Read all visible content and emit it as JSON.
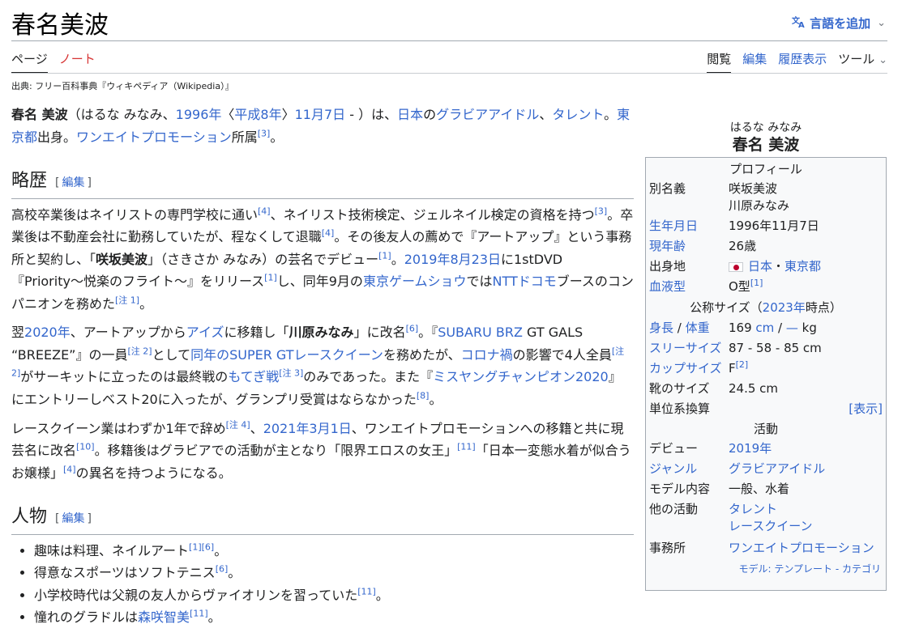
{
  "header": {
    "title": "春名美波",
    "lang_button": "言語を追加",
    "lang_icon": "translate-icon"
  },
  "tabs": {
    "page": "ページ",
    "talk": "ノート",
    "read": "閲覧",
    "edit": "編集",
    "history": "履歴表示",
    "tools": "ツール"
  },
  "source": "出典: フリー百科事典『ウィキペディア（Wikipedia）』",
  "intro": {
    "name_bold": "春名 美波",
    "t1": "（はるな みなみ、",
    "l_1996": "1996年",
    "t2": "〈",
    "l_heisei": "平成8年",
    "t3": "〉",
    "l_nov7": "11月7日",
    "t4": " - ）は、",
    "l_japan": "日本",
    "t5": "の",
    "l_gravure": "グラビアアイドル",
    "t6": "、",
    "l_talent": "タレント",
    "t7": "。",
    "l_tokyo": "東京都",
    "t8": "出身。",
    "l_oneeight": "ワンエイトプロモーション",
    "t9": "所属",
    "ref": "[3]",
    "t10": "。"
  },
  "section1": {
    "heading": "略歴",
    "edit_open": "[",
    "edit": "編集",
    "edit_close": "]",
    "p1": {
      "a": "高校卒業後はネイリストの専門学校に通い",
      "r1": "[4]",
      "b": "、ネイリスト技術検定、ジェルネイル検定の資格を持つ",
      "r2": "[3]",
      "c": "。卒業後は不動産会社に勤務していたが、程なくして退職",
      "r3": "[4]",
      "d": "。その後友人の薦めで『アートアップ』という事務所と契約し、「",
      "bold": "咲坂美波",
      "e": "」（さきさか みなみ）の芸名でデビュー",
      "r4": "[1]",
      "f": "。",
      "l_date": "2019年8月23日",
      "g": "に1stDVD『Priority〜悦楽のフライト〜』をリリース",
      "r5": "[1]",
      "h": "し、同年9月の",
      "l_tgs": "東京ゲームショウ",
      "i": "では",
      "l_ntt": "NTTドコモ",
      "j": "ブースのコンパニオンを務めた",
      "r6": "[注 1]",
      "k": "。"
    },
    "p2": {
      "a": "翌",
      "l_2020": "2020年",
      "b": "、アートアップから",
      "l_ize": "アイズ",
      "c": "に移籍し「",
      "bold": "川原みなみ",
      "d": "」に改名",
      "r1": "[6]",
      "e": "。『",
      "l_brz": "SUBARU BRZ",
      "f": " GT GALS “BREEZE”』の一員",
      "r2": "[注 2]",
      "g": "として",
      "l_super": "同年のSUPER GTレースクイーン",
      "h": "を務めたが、",
      "l_corona": "コロナ禍",
      "i": "の影響で4人全員",
      "r3": "[注 2]",
      "j": "がサーキットに立ったのは最終戦の",
      "l_motegi": "もてぎ戦",
      "r4": "[注 3]",
      "k": "のみであった。また『",
      "l_miss": "ミスヤングチャンピオン2020",
      "l": "』にエントリーしベスト20に入ったが、グランプリ受賞はならなかった",
      "r5": "[8]",
      "m": "。"
    },
    "p3": {
      "a": "レースクイーン業はわずか1年で辞め",
      "r1": "[注 4]",
      "b": "、",
      "l_date": "2021年3月1日",
      "c": "、ワンエイトプロモーションへの移籍と共に現芸名に改名",
      "r2": "[10]",
      "d": "。移籍後はグラビアでの活動が主となり「限界エロスの女王」",
      "r3": "[11]",
      "e": "「日本一変態水着が似合うお嬢様」",
      "r4": "[4]",
      "f": "の異名を持つようになる。"
    }
  },
  "section2": {
    "heading": "人物",
    "edit_open": "[",
    "edit": "編集",
    "edit_close": "]",
    "items": [
      {
        "text": "趣味は料理、ネイルアート",
        "ref": "[1][6]",
        "end": "。"
      },
      {
        "text": "得意なスポーツはソフトテニス",
        "ref": "[6]",
        "end": "。"
      },
      {
        "text": "小学校時代は父親の友人からヴァイオリンを習っていた",
        "ref": "[11]",
        "end": "。"
      },
      {
        "text": "憧れのグラドルは",
        "link": "森咲智美",
        "ref": "[11]",
        "end": "。"
      }
    ]
  },
  "infobox": {
    "kana": "はるな みなみ",
    "name": "春名 美波",
    "profile_header": "プロフィール",
    "alias_label": "別名義",
    "alias_1": "咲坂美波",
    "alias_2": "川原みなみ",
    "birth_label": "生年月日",
    "birth": "1996年11月7日",
    "age_label": "現年齢",
    "age": "26歳",
    "origin_label": "出身地",
    "origin_country": "日本",
    "origin_sep": "・",
    "origin_pref": "東京都",
    "blood_label": "血液型",
    "blood": "O型",
    "blood_ref": "[1]",
    "size_header_a": "公称サイズ（",
    "size_header_link": "2023年",
    "size_header_b": "時点）",
    "height_label": "身長",
    "hw_sep": " / ",
    "weight_label": "体重",
    "height": "169 ",
    "height_unit": "cm",
    "weight": "—",
    "weight_unit": " kg",
    "three_label": "スリーサイズ",
    "three": "87 - 58 - 85 cm",
    "cup_label": "カップサイズ",
    "cup": "F",
    "cup_ref": "[2]",
    "shoe_label": "靴のサイズ",
    "shoe": "24.5 cm",
    "unit_label": "単位系換算",
    "unit_show": "[表示]",
    "activity_header": "活動",
    "debut_label": "デビュー",
    "debut": "2019年",
    "genre_label": "ジャンル",
    "genre": "グラビアアイドル",
    "model_label": "モデル内容",
    "model": "一般、水着",
    "other_label": "他の活動",
    "other_1": "タレント",
    "other_2": "レースクイーン",
    "agency_label": "事務所",
    "agency": "ワンエイトプロモーション",
    "footer_a": "モデル: ",
    "footer_link1": "テンプレート",
    "footer_sep": " - ",
    "footer_link2": "カテゴリ"
  }
}
